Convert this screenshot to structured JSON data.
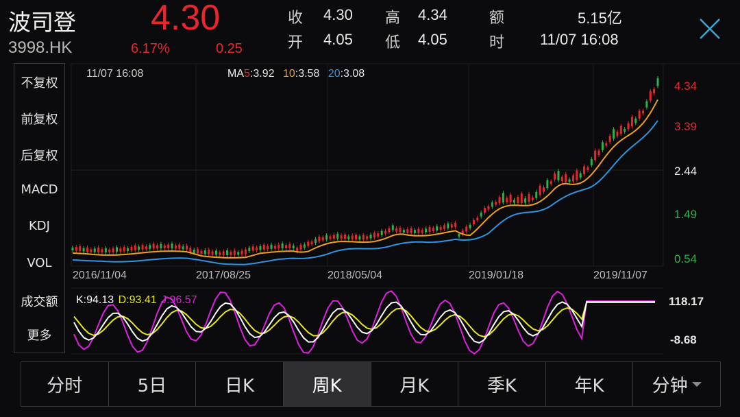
{
  "stock": {
    "name": "波司登",
    "code": "3998.HK",
    "price": "4.30",
    "change_pct": "6.17%",
    "change": "0.25"
  },
  "stats": {
    "close_label": "收",
    "close_value": "4.30",
    "high_label": "高",
    "high_value": "4.34",
    "amount_label": "额",
    "amount_value": "5.15亿",
    "open_label": "开",
    "open_value": "4.05",
    "low_label": "低",
    "low_value": "4.05",
    "time_label": "时",
    "time_value": "11/07 16:08"
  },
  "menu": {
    "items": [
      {
        "label": "不复权",
        "active": true
      },
      {
        "label": "前复权",
        "active": false
      },
      {
        "label": "后复权",
        "active": false
      },
      {
        "label": "MACD",
        "active": false
      },
      {
        "label": "KDJ",
        "active": true
      },
      {
        "label": "VOL",
        "active": false
      },
      {
        "label": "成交额",
        "active": false
      },
      {
        "label": "更多",
        "active": false
      }
    ]
  },
  "main_chart": {
    "timestamp": "11/07 16:08",
    "ma5_label": "MA5",
    "ma5_value": ":3.92",
    "ma10_label": "10",
    "ma10_value": ":3.58",
    "ma20_label": "20",
    "ma20_value": ":3.08",
    "y_ticks": [
      "4.34",
      "3.39",
      "2.44",
      "1.49",
      "0.54"
    ],
    "x_ticks": [
      "2016/11/04",
      "2017/08/25",
      "2018/05/04",
      "2019/01/18",
      "2019/11/07"
    ]
  },
  "kdj": {
    "k_label": "K:94.13",
    "d_label": "D:93.41",
    "j_label": "J:96.57",
    "top_tick": "118.17",
    "bottom_tick": "-8.68"
  },
  "tabs": [
    {
      "label": "分时",
      "active": false
    },
    {
      "label": "5日",
      "active": false
    },
    {
      "label": "日K",
      "active": false
    },
    {
      "label": "周K",
      "active": true
    },
    {
      "label": "月K",
      "active": false
    },
    {
      "label": "季K",
      "active": false
    },
    {
      "label": "年K",
      "active": false
    },
    {
      "label": "分钟",
      "active": false,
      "dropdown": true
    }
  ],
  "colors": {
    "up": "#e8262d",
    "down": "#2bb34a",
    "ma5": "#f2f2f2",
    "ma10": "#f0a020",
    "ma20": "#2f95e0",
    "k": "#ffffff",
    "d": "#e8e820",
    "j": "#e020e0",
    "accent_blue": "#3a8fe0"
  },
  "icons": {
    "close": "close-icon"
  }
}
